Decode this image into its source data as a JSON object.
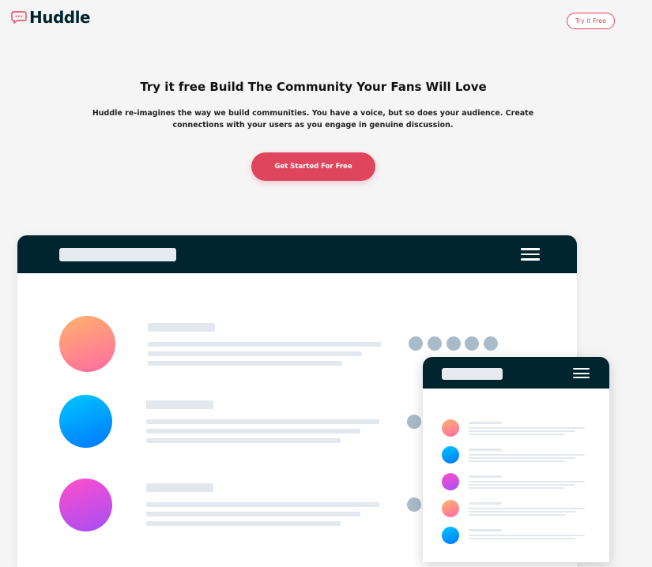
{
  "brand": {
    "name": "Huddle",
    "icon": "chat-bubble-icon",
    "accent": "#e0455e",
    "dark": "#00252e"
  },
  "header": {
    "try_button": "Try it Free"
  },
  "hero": {
    "title": "Try it free Build The Community Your Fans Will Love",
    "text": "Huddle re-imagines the way we build communities. You have a voice, but so does your audience. Create connections with your users as you engage in genuine discussion.",
    "cta": "Get Started For Free"
  },
  "mockup": {
    "desktop_nav_icon": "hamburger-menu-icon",
    "mobile_nav_icon": "hamburger-menu-icon"
  }
}
